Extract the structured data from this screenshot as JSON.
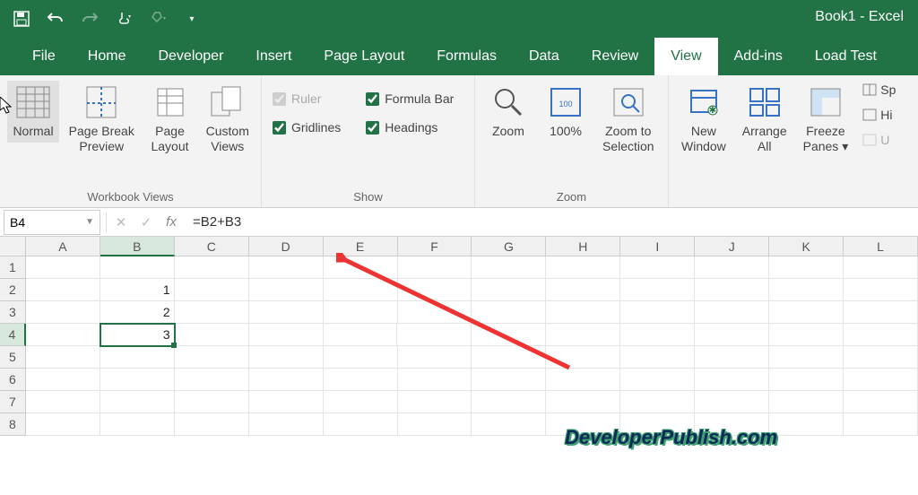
{
  "app_title": "Book1 - Excel",
  "tabs": [
    "File",
    "Home",
    "Developer",
    "Insert",
    "Page Layout",
    "Formulas",
    "Data",
    "Review",
    "View",
    "Add-ins",
    "Load Test"
  ],
  "active_tab": "View",
  "ribbon": {
    "workbook_views": {
      "label": "Workbook Views",
      "normal": "Normal",
      "page_break": "Page Break\nPreview",
      "page_layout": "Page\nLayout",
      "custom": "Custom\nViews"
    },
    "show": {
      "label": "Show",
      "ruler": "Ruler",
      "gridlines": "Gridlines",
      "formula_bar": "Formula Bar",
      "headings": "Headings"
    },
    "zoom": {
      "label": "Zoom",
      "zoom": "Zoom",
      "hundred": "100%",
      "selection": "Zoom to\nSelection"
    },
    "window": {
      "new_window": "New\nWindow",
      "arrange": "Arrange\nAll",
      "freeze": "Freeze\nPanes ▾",
      "split": "Sp",
      "hide": "Hi",
      "unhide": "U"
    }
  },
  "namebox": "B4",
  "formula": "=B2+B3",
  "columns": [
    "A",
    "B",
    "C",
    "D",
    "E",
    "F",
    "G",
    "H",
    "I",
    "J",
    "K",
    "L"
  ],
  "rows": [
    "1",
    "2",
    "3",
    "4",
    "5",
    "6",
    "7",
    "8"
  ],
  "cells": {
    "B2": "1",
    "B3": "2",
    "B4": "3"
  },
  "selected_cell": "B4",
  "watermark": "DeveloperPublish.com"
}
